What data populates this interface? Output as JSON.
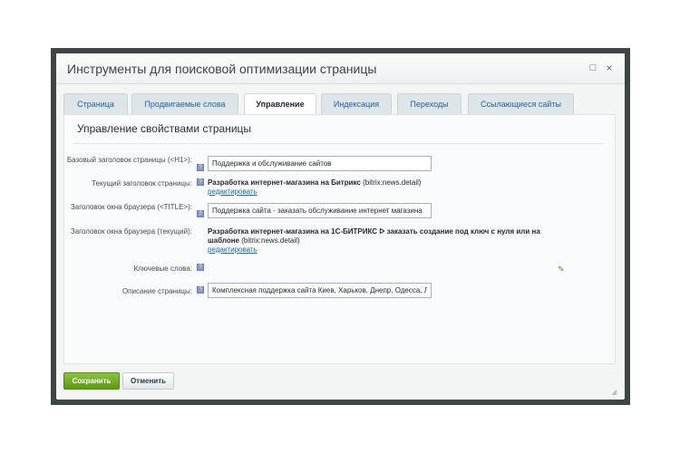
{
  "dialog": {
    "title": "Инструменты для поисковой оптимизации страницы",
    "maximize_icon": "□",
    "close_icon": "×"
  },
  "tabs": [
    {
      "label": "Страница",
      "active": false
    },
    {
      "label": "Продвигаемые слова",
      "active": false
    },
    {
      "label": "Управление",
      "active": true
    },
    {
      "label": "Индексация",
      "active": false
    },
    {
      "label": "Переходы",
      "active": false
    },
    {
      "label": "Ссылающиеся сайты",
      "active": false
    }
  ],
  "section": {
    "title": "Управление свойствами страницы"
  },
  "fields": {
    "base_h1": {
      "label": "Базовый заголовок страницы (<H1>):",
      "value": "Поддержка и обслуживание сайтов"
    },
    "current_h1": {
      "label": "Текущий заголовок страницы:",
      "value_bold": "Разработка интернет-магазина на Битрикс",
      "source": "(bitrix:news.detail)",
      "edit_link": "редактировать"
    },
    "title_tag": {
      "label": "Заголовок окна браузера (<TITLE>):",
      "value": "Поддержка сайта - заказать обслуживание интернет магазина"
    },
    "current_title": {
      "label": "Заголовок окна браузера (текущий):",
      "value_bold": "Разработка интернет-магазина на 1С-БИТРИКС ᐅ заказать создание под ключ с нуля или на шаблоне",
      "source": "(bitrix:news.detail)",
      "edit_link": "редактировать"
    },
    "keywords": {
      "label": "Ключевые слова:",
      "pencil_icon": "✎"
    },
    "description": {
      "label": "Описание страницы:",
      "value": "Комплексная поддержка сайта Киев, Харьков, Днепр, Одесса, Львов"
    }
  },
  "hint_icon": "?",
  "buttons": {
    "save": "Сохранить",
    "cancel": "Отменить"
  },
  "resize_grip": "◢",
  "colors": {
    "save_green": "#6aa81f",
    "link_blue": "#2067b0",
    "backdrop": "#3f4447"
  }
}
